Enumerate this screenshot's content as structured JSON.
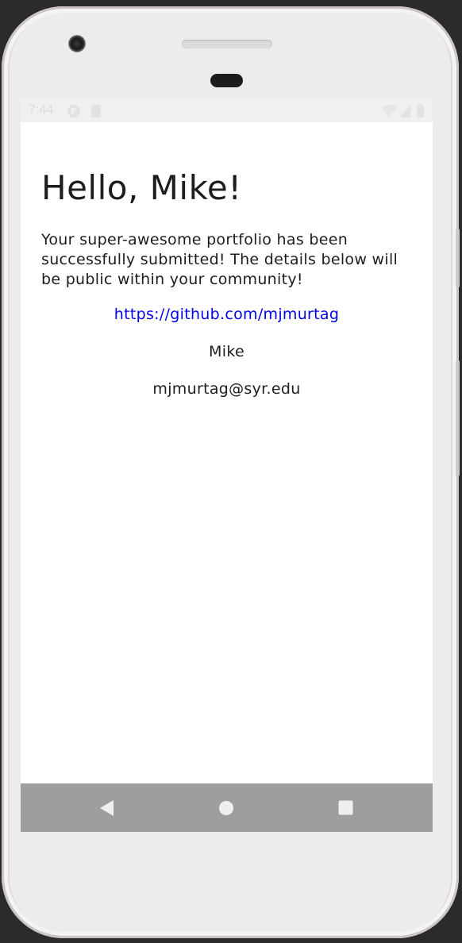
{
  "status_bar": {
    "time": "7:44",
    "icons": [
      "notification-app-icon",
      "sd-card-icon",
      "wifi-icon",
      "cell-signal-icon",
      "battery-icon"
    ]
  },
  "main": {
    "greeting": "Hello, Mike!",
    "message": "Your super-awesome portfolio has been successfully submitted! The details below will be public within your community!",
    "portfolio_link": "https://github.com/mjmurtag",
    "name": "Mike",
    "email": "mjmurtag@syr.edu"
  },
  "nav_bar": {
    "buttons": [
      "back-icon",
      "home-icon",
      "recents-icon"
    ]
  },
  "colors": {
    "link": "#0000ee",
    "text": "#1d1d1d",
    "nav_bar": "#9e9e9e",
    "status_bar": "#f0f0f2"
  }
}
